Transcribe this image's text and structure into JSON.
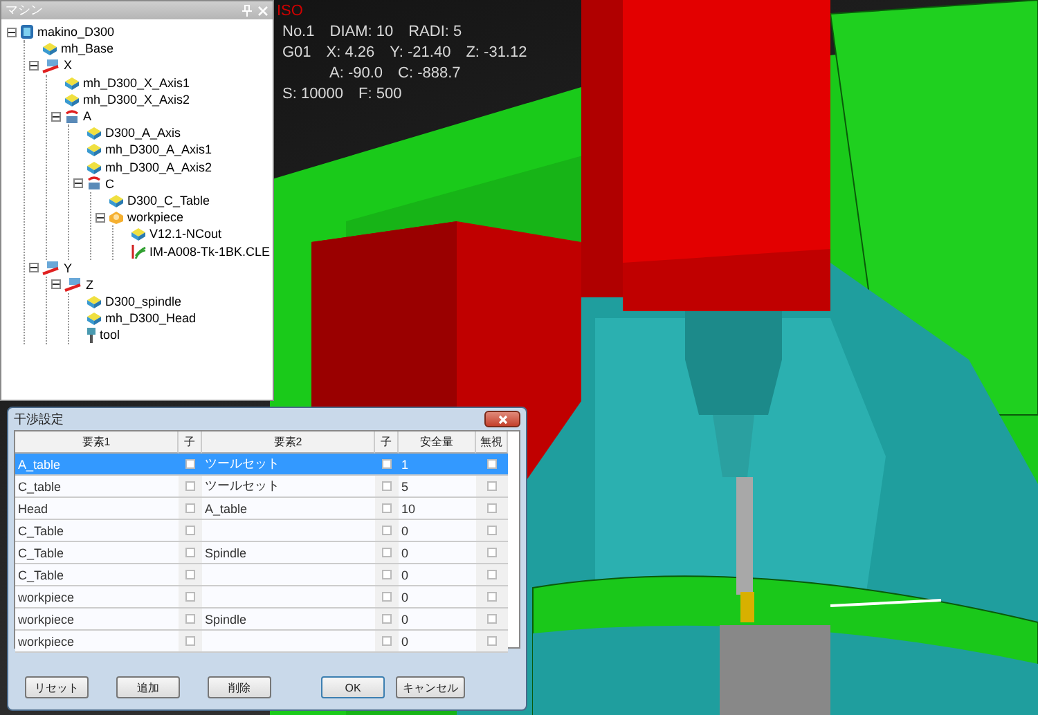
{
  "hud": {
    "view": "ISO",
    "lines": [
      {
        "indent": false,
        "items": [
          "No.1",
          "DIAM: 10",
          "RADI: 5"
        ]
      },
      {
        "indent": false,
        "items": [
          "G01",
          "X: 4.26",
          "Y: -21.40",
          "Z: -31.12"
        ]
      },
      {
        "indent": true,
        "items": [
          "A: -90.0",
          "C: -888.7"
        ]
      },
      {
        "indent": false,
        "items": [
          "S: 10000",
          "F: 500"
        ]
      }
    ]
  },
  "tree_panel": {
    "title": "マシン",
    "tree": [
      {
        "label": "makino_D300",
        "kind": "machine",
        "expanded": true,
        "children": [
          {
            "label": "mh_Base",
            "kind": "part"
          },
          {
            "label": "X",
            "kind": "linear",
            "expanded": true,
            "children": [
              {
                "label": "mh_D300_X_Axis1",
                "kind": "part"
              },
              {
                "label": "mh_D300_X_Axis2",
                "kind": "part"
              },
              {
                "label": "A",
                "kind": "rotary",
                "expanded": true,
                "children": [
                  {
                    "label": "D300_A_Axis",
                    "kind": "part"
                  },
                  {
                    "label": "mh_D300_A_Axis1",
                    "kind": "part"
                  },
                  {
                    "label": "mh_D300_A_Axis2",
                    "kind": "part"
                  },
                  {
                    "label": "C",
                    "kind": "rotary",
                    "expanded": true,
                    "children": [
                      {
                        "label": "D300_C_Table",
                        "kind": "part"
                      },
                      {
                        "label": "workpiece",
                        "kind": "workpiece",
                        "expanded": true,
                        "children": [
                          {
                            "label": "V12.1-NCout",
                            "kind": "part"
                          },
                          {
                            "label": "IM-A008-Tk-1BK.CLE",
                            "kind": "toolpath"
                          }
                        ]
                      }
                    ]
                  }
                ]
              }
            ]
          },
          {
            "label": "Y",
            "kind": "linear",
            "expanded": true,
            "children": [
              {
                "label": "Z",
                "kind": "linear",
                "expanded": true,
                "children": [
                  {
                    "label": "D300_spindle",
                    "kind": "part"
                  },
                  {
                    "label": "mh_D300_Head",
                    "kind": "part"
                  },
                  {
                    "label": "tool",
                    "kind": "tool"
                  }
                ]
              }
            ]
          }
        ]
      }
    ]
  },
  "dialog": {
    "title": "干渉設定",
    "columns": [
      "要素1",
      "子",
      "要素2",
      "子",
      "安全量",
      "無視"
    ],
    "rows": [
      {
        "element1": "A_table",
        "child1": false,
        "element2": "ツールセット",
        "child2": false,
        "safety": "1",
        "ignore": false,
        "selected": true
      },
      {
        "element1": "C_table",
        "child1": false,
        "element2": "ツールセット",
        "child2": false,
        "safety": "5",
        "ignore": false,
        "selected": false
      },
      {
        "element1": "Head",
        "child1": false,
        "element2": "A_table",
        "child2": false,
        "safety": "10",
        "ignore": false,
        "selected": false
      },
      {
        "element1": "C_Table",
        "child1": false,
        "child2": false,
        "safety": "0",
        "ignore": false,
        "selected": false
      },
      {
        "element1": "C_Table",
        "child1": false,
        "element2": "Spindle",
        "child2": false,
        "safety": "0",
        "ignore": false,
        "selected": false
      },
      {
        "element1": "C_Table",
        "child1": false,
        "child2": false,
        "safety": "0",
        "ignore": false,
        "selected": false
      },
      {
        "element1": "workpiece",
        "child1": false,
        "child2": false,
        "safety": "0",
        "ignore": false,
        "selected": false
      },
      {
        "element1": "workpiece",
        "child1": false,
        "element2": "Spindle",
        "child2": false,
        "safety": "0",
        "ignore": false,
        "selected": false
      },
      {
        "element1": "workpiece",
        "child1": false,
        "child2": false,
        "safety": "0",
        "ignore": false,
        "selected": false
      }
    ],
    "buttons": [
      {
        "label": "リセット",
        "kind": "left"
      },
      {
        "label": "追加",
        "kind": "middle"
      },
      {
        "label": "削除",
        "kind": "middle"
      },
      {
        "label": "OK",
        "kind": "default"
      },
      {
        "label": "キャンセル",
        "kind": "right"
      }
    ]
  }
}
